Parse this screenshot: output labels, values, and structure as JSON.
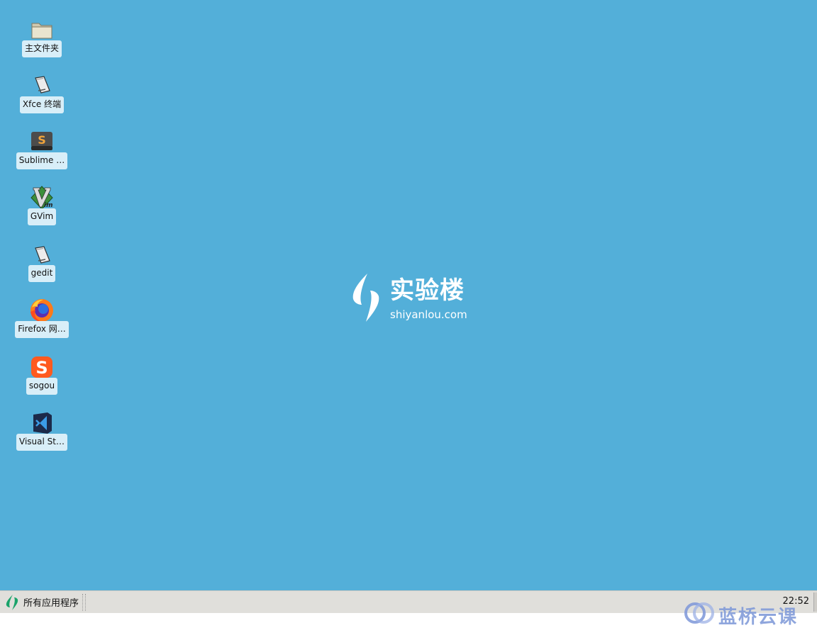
{
  "desktop": {
    "icons": [
      {
        "label": "主文件夹",
        "icon": "folder-icon"
      },
      {
        "label": "Xfce 终端",
        "icon": "terminal-icon"
      },
      {
        "label": "Sublime …",
        "icon": "sublime-icon"
      },
      {
        "label": "GVim",
        "icon": "vim-icon"
      },
      {
        "label": "gedit",
        "icon": "gedit-icon"
      },
      {
        "label": "Firefox 网…",
        "icon": "firefox-icon"
      },
      {
        "label": "sogou",
        "icon": "sogou-icon"
      },
      {
        "label": "Visual St…",
        "icon": "vscode-icon"
      }
    ],
    "background_color": "#53afd9",
    "wallpaper_logo": {
      "cn": "实验楼",
      "en": "shiyanlou.com"
    }
  },
  "taskbar": {
    "menu_label": "所有应用程序",
    "clock": "22:52"
  },
  "watermark": {
    "text": "蓝桥云课"
  }
}
